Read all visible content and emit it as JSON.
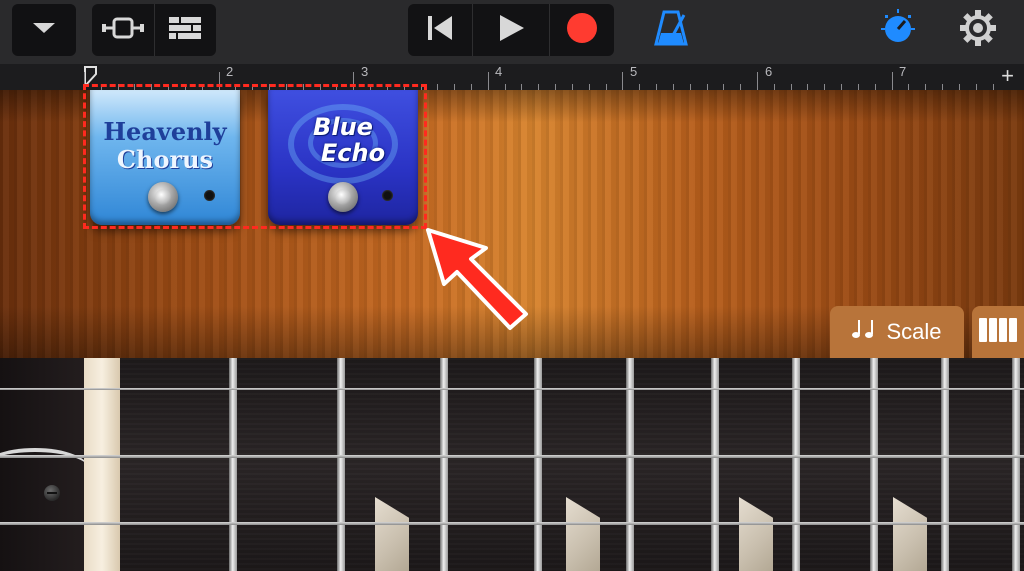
{
  "toolbar": {
    "menu_icon": "chevron-down-icon",
    "view_icons": [
      "track-view-icon",
      "mixer-icon"
    ],
    "transport_icons": [
      "go-to-beginning-icon",
      "play-icon",
      "record-icon"
    ],
    "metronome_icon": "metronome-icon",
    "master_effects_icon": "master-effects-knob-icon",
    "settings_icon": "gear-icon",
    "accent_color": "#1f8bff",
    "record_color": "#ff3b30"
  },
  "ruler": {
    "bars": [
      "2",
      "3",
      "4",
      "5",
      "6",
      "7"
    ],
    "add_section_label": "+"
  },
  "pedals": [
    {
      "name": "Heavenly Chorus",
      "line1": "Heavenly",
      "line2": "Chorus",
      "color": "#3a8fe0"
    },
    {
      "name": "Blue Echo",
      "line1": "Blue",
      "line2": "Echo",
      "color": "#2a33c4"
    }
  ],
  "annotation": {
    "highlight_color": "#ff2a1f",
    "arrow_color": "#ff2a1f"
  },
  "scale_button": {
    "icon": "music-notes-icon",
    "label": "Scale"
  },
  "fretboard_toggle_icon": "notes-grid-icon",
  "colors": {
    "wood": "#c66a22",
    "fretboard": "#241f20",
    "nut": "#f1e6d2"
  }
}
